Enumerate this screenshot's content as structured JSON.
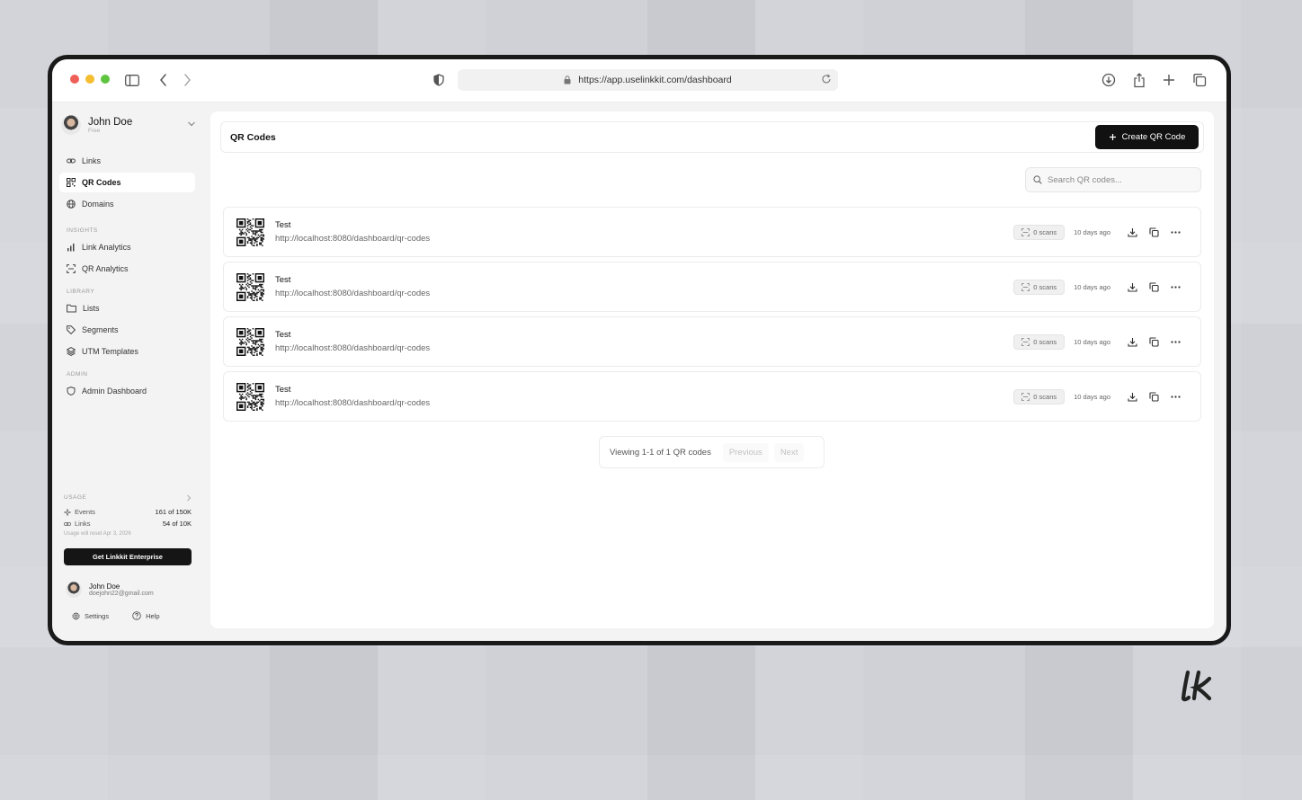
{
  "browser": {
    "url": "https://app.uselinkkit.com/dashboard",
    "traffic_colors": [
      "#ee5f57",
      "#f5bd30",
      "#5fc43f"
    ]
  },
  "sidebar": {
    "user_name": "John Doe",
    "user_plan": "Free",
    "nav_main": [
      {
        "label": "Links",
        "icon": "link-icon"
      },
      {
        "label": "QR Codes",
        "icon": "qr-icon",
        "active": true
      },
      {
        "label": "Domains",
        "icon": "globe-icon"
      }
    ],
    "insights_label": "INSIGHTS",
    "nav_insights": [
      {
        "label": "Link Analytics",
        "icon": "bar-chart-icon"
      },
      {
        "label": "QR Analytics",
        "icon": "scan-icon"
      }
    ],
    "library_label": "LIBRARY",
    "nav_library": [
      {
        "label": "Lists",
        "icon": "folder-icon"
      },
      {
        "label": "Segments",
        "icon": "tag-icon"
      },
      {
        "label": "UTM Templates",
        "icon": "layers-icon"
      }
    ],
    "admin_label": "ADMIN",
    "nav_admin": [
      {
        "label": "Admin Dashboard",
        "icon": "shield-icon"
      }
    ],
    "usage": {
      "label": "USAGE",
      "events_label": "Events",
      "events_value": "161 of 150K",
      "links_label": "Links",
      "links_value": "54 of 10K",
      "reset_note": "Usage will reset Apr 3, 2026"
    },
    "enterprise_button": "Get Linkkit Enterprise",
    "footer_user_name": "John Doe",
    "footer_user_email": "doejohn22@gmail.com",
    "settings_label": "Settings",
    "help_label": "Help"
  },
  "main": {
    "title": "QR Codes",
    "create_button": "Create QR Code",
    "search_placeholder": "Search QR codes...",
    "qr_codes": [
      {
        "name": "Test",
        "url": "http://localhost:8080/dashboard/qr-codes",
        "scans": "0 scans",
        "when": "10 days ago"
      },
      {
        "name": "Test",
        "url": "http://localhost:8080/dashboard/qr-codes",
        "scans": "0 scans",
        "when": "10 days ago"
      },
      {
        "name": "Test",
        "url": "http://localhost:8080/dashboard/qr-codes",
        "scans": "0 scans",
        "when": "10 days ago"
      },
      {
        "name": "Test",
        "url": "http://localhost:8080/dashboard/qr-codes",
        "scans": "0 scans",
        "when": "10 days ago"
      }
    ],
    "pagination": {
      "summary": "Viewing 1-1 of 1 QR codes",
      "previous": "Previous",
      "next": "Next"
    }
  },
  "brand_logo": "lk"
}
